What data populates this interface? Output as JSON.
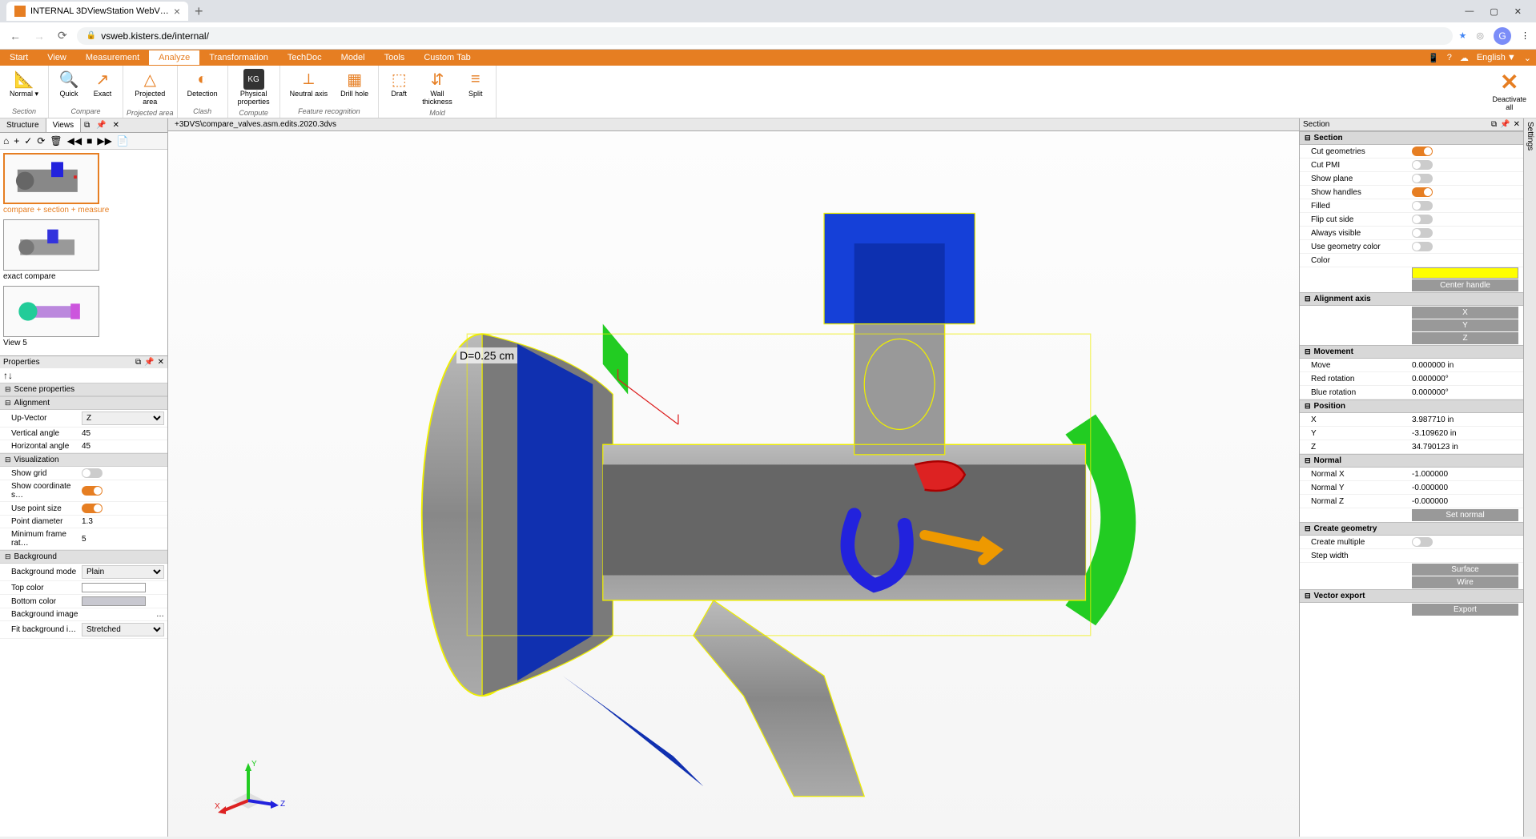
{
  "browser": {
    "tab_title": "INTERNAL 3DViewStation WebV…",
    "url": "vsweb.kisters.de/internal/",
    "avatar_letter": "G"
  },
  "menu": {
    "items": [
      "Start",
      "View",
      "Measurement",
      "Analyze",
      "Transformation",
      "TechDoc",
      "Model",
      "Tools",
      "Custom Tab"
    ],
    "active": "Analyze",
    "language": "English"
  },
  "ribbon": {
    "groups": [
      {
        "label": "Section",
        "items": [
          {
            "label": "Normal ▾",
            "icon": "⬛"
          }
        ]
      },
      {
        "label": "Compare",
        "items": [
          {
            "label": "Quick",
            "icon": "◷"
          },
          {
            "label": "Exact",
            "icon": "⤴"
          }
        ]
      },
      {
        "label": "Projected area",
        "items": [
          {
            "label": "Projected\narea",
            "icon": "△"
          }
        ]
      },
      {
        "label": "Clash",
        "items": [
          {
            "label": "Detection",
            "icon": "◐"
          }
        ]
      },
      {
        "label": "Compute",
        "items": [
          {
            "label": "Physical\nproperties",
            "icon": "KG"
          }
        ]
      },
      {
        "label": "Feature recognition",
        "items": [
          {
            "label": "Neutral axis",
            "icon": "⟂"
          },
          {
            "label": "Drill hole",
            "icon": "▦"
          }
        ]
      },
      {
        "label": "Mold",
        "items": [
          {
            "label": "Draft",
            "icon": "⬚"
          },
          {
            "label": "Wall\nthickness",
            "icon": "⇵"
          },
          {
            "label": "Split",
            "icon": "≡"
          }
        ]
      }
    ],
    "deactivate": "Deactivate\nall"
  },
  "left": {
    "tabs": [
      "Structure",
      "Views"
    ],
    "active_tab": "Views",
    "views": [
      {
        "label": "compare + section + measure",
        "active": true
      },
      {
        "label": "exact compare",
        "active": false
      },
      {
        "label": "View 5",
        "active": false
      }
    ],
    "properties_title": "Properties",
    "scene_props_title": "Scene properties",
    "alignment": {
      "title": "Alignment",
      "up_vector_label": "Up-Vector",
      "up_vector": "Z",
      "vertical_label": "Vertical angle",
      "vertical": "45",
      "horizontal_label": "Horizontal angle",
      "horizontal": "45"
    },
    "visualization": {
      "title": "Visualization",
      "show_grid_label": "Show grid",
      "show_grid": false,
      "show_coord_label": "Show coordinate s…",
      "show_coord": true,
      "use_point_label": "Use point size",
      "use_point": true,
      "point_diam_label": "Point diameter",
      "point_diam": "1.3",
      "min_frame_label": "Minimum frame rat…",
      "min_frame": "5"
    },
    "background": {
      "title": "Background",
      "mode_label": "Background mode",
      "mode": "Plain",
      "top_label": "Top color",
      "top_color": "#ffffff",
      "bottom_label": "Bottom color",
      "bottom_color": "#c8c8d0",
      "image_label": "Background image",
      "image": "",
      "fit_label": "Fit background i…",
      "fit": "Stretched"
    }
  },
  "viewport": {
    "file_path": "+3DVS\\compare_valves.asm.edits.2020.3dvs",
    "measurement": "D=0.25 cm",
    "axes": {
      "x": "X",
      "y": "Y",
      "z": "Z"
    }
  },
  "right": {
    "title": "Section",
    "settings_label": "Settings",
    "section": {
      "title": "Section",
      "cut_geo_label": "Cut geometries",
      "cut_geo": true,
      "cut_pmi_label": "Cut PMI",
      "cut_pmi": false,
      "show_plane_label": "Show plane",
      "show_plane": false,
      "show_handles_label": "Show handles",
      "show_handles": true,
      "filled_label": "Filled",
      "filled": false,
      "flip_label": "Flip cut side",
      "flip": false,
      "always_label": "Always visible",
      "always": false,
      "use_geo_color_label": "Use geometry color",
      "use_geo_color": false,
      "color_label": "Color",
      "center_handle": "Center handle"
    },
    "alignment_axis": {
      "title": "Alignment axis",
      "x": "X",
      "y": "Y",
      "z": "Z"
    },
    "movement": {
      "title": "Movement",
      "move_label": "Move",
      "move": "0.000000 in",
      "red_label": "Red rotation",
      "red": "0.000000°",
      "blue_label": "Blue rotation",
      "blue": "0.000000°"
    },
    "position": {
      "title": "Position",
      "x_label": "X",
      "x": "3.987710 in",
      "y_label": "Y",
      "y": "-3.109620 in",
      "z_label": "Z",
      "z": "34.790123 in"
    },
    "normal": {
      "title": "Normal",
      "x_label": "Normal X",
      "x": "-1.000000",
      "y_label": "Normal Y",
      "y": "-0.000000",
      "z_label": "Normal Z",
      "z": "-0.000000",
      "set": "Set normal"
    },
    "create_geo": {
      "title": "Create geometry",
      "multiple_label": "Create multiple",
      "multiple": false,
      "step_label": "Step width",
      "step": "",
      "surface": "Surface",
      "wire": "Wire"
    },
    "vector": {
      "title": "Vector export",
      "export": "Export"
    }
  }
}
